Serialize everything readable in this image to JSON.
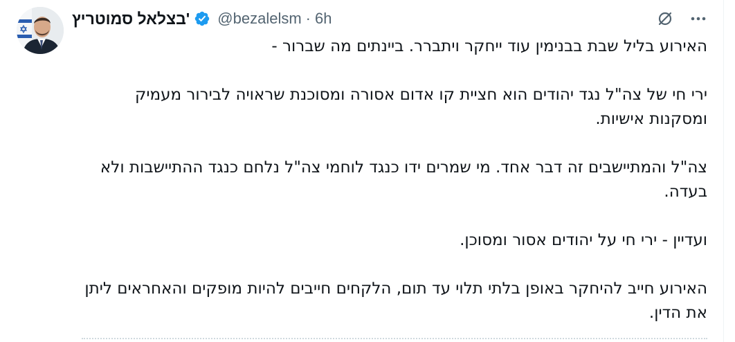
{
  "tweet": {
    "author": {
      "display_name": "'בצלאל סמוטריץ",
      "handle": "@bezalelsm",
      "separator": "·",
      "timestamp": "6h",
      "verified_icon": "verified-badge-icon",
      "avatar_icon": "profile-photo"
    },
    "actions": {
      "grok_icon": "slashed-circle-icon",
      "more_icon": "more-dots-icon"
    },
    "paragraphs": [
      "האירוע בליל שבת בבנימין עוד ייחקר ויתברר. ביינתים מה שברור -",
      "ירי חי של צה\"ל נגד יהודים הוא חציית קו אדום אסורה ומסוכנת שראויה לבירור מעמיק ומסקנות אישיות.",
      "צה\"ל והמתיישבים זה דבר אחד. מי שמרים ידו כנגד לוחמי צה\"ל נלחם כנגד ההתיישבות ולא בעדה.",
      "ועדיין - ירי חי על  יהודים אסור ומסוכן.",
      "האירוע חייב להיחקר באופן בלתי תלוי עד תום, הלקחים חייבים להיות מופקים והאחראים ליתן את הדין."
    ]
  },
  "colors": {
    "text": "#0f1419",
    "secondary": "#536471",
    "verified": "#1d9bf0",
    "divider": "#cfd9de"
  }
}
